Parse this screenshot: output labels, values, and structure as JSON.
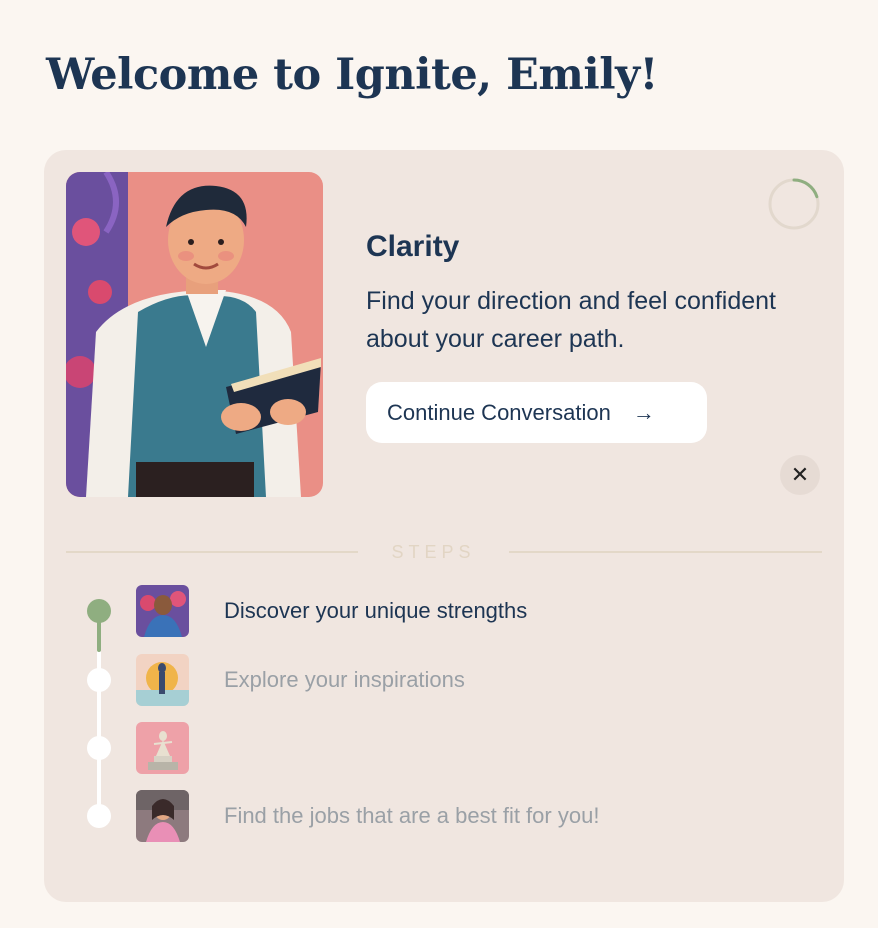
{
  "page": {
    "title": "Welcome to Ignite, Emily!"
  },
  "stage": {
    "title": "Clarity",
    "description": "Find your direction and feel confident about your career path.",
    "continue_label": "Continue Conversation",
    "continue_icon": "→",
    "close_icon": "✕",
    "progress": 0.2
  },
  "steps": {
    "label": "STEPS",
    "items": [
      {
        "label": "Discover your unique strengths",
        "state": "active"
      },
      {
        "label": "Explore your inspirations",
        "state": "pending"
      },
      {
        "label": "",
        "state": "pending"
      },
      {
        "label": "Find the jobs that are a best fit for you!",
        "state": "pending"
      }
    ]
  },
  "colors": {
    "navy": "#1d3553",
    "accent_green": "#8fae80",
    "card_bg": "#f0e6e0",
    "page_bg": "#fbf6f1"
  }
}
